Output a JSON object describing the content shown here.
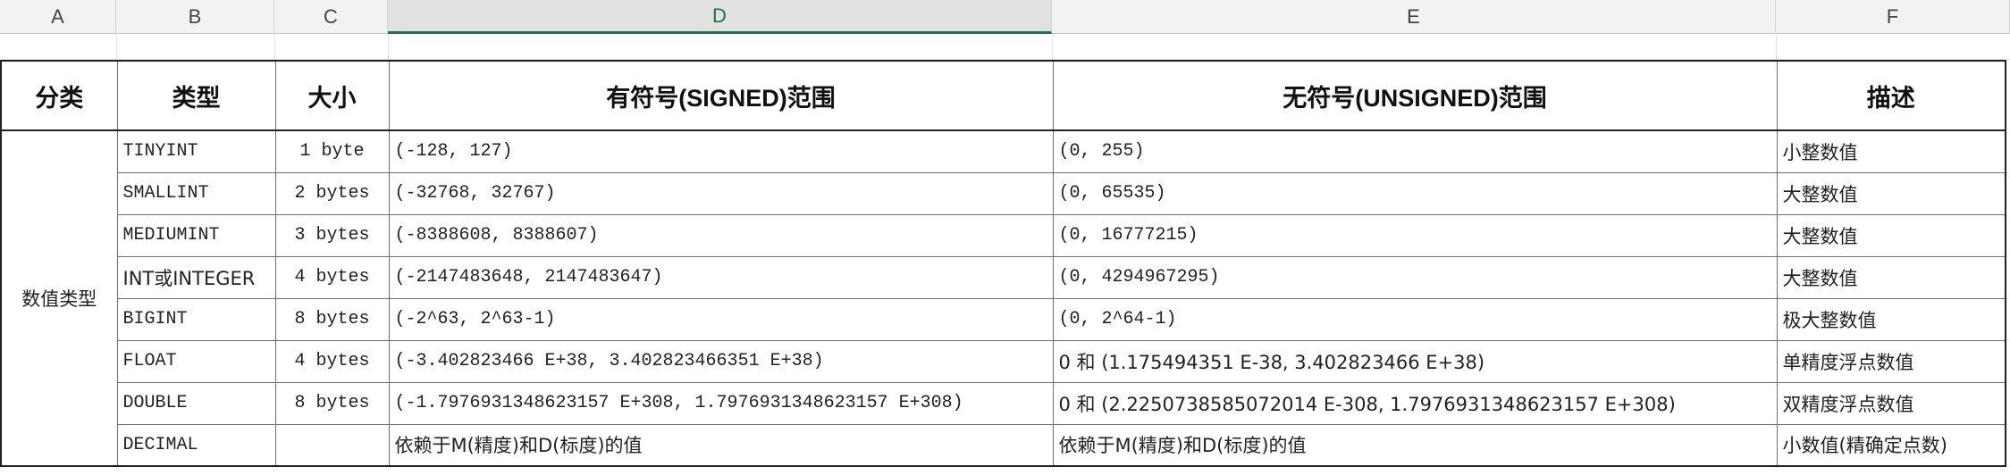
{
  "columns": [
    "A",
    "B",
    "C",
    "D",
    "E",
    "F"
  ],
  "active_column": "D",
  "table": {
    "headers": {
      "category": "分类",
      "type": "类型",
      "size": "大小",
      "signed": "有符号(SIGNED)范围",
      "unsigned": "无符号(UNSIGNED)范围",
      "desc": "描述"
    },
    "category": "数值类型",
    "rows": [
      {
        "type": "TINYINT",
        "size": "1 byte",
        "signed": "(-128, 127)",
        "unsigned": "(0, 255)",
        "desc": "小整数值"
      },
      {
        "type": "SMALLINT",
        "size": "2 bytes",
        "signed": "(-32768, 32767)",
        "unsigned": "(0, 65535)",
        "desc": "大整数值"
      },
      {
        "type": "MEDIUMINT",
        "size": "3 bytes",
        "signed": "(-8388608, 8388607)",
        "unsigned": "(0, 16777215)",
        "desc": "大整数值"
      },
      {
        "type": "INT或INTEGER",
        "size": "4 bytes",
        "signed": "(-2147483648, 2147483647)",
        "unsigned": "(0, 4294967295)",
        "desc": "大整数值"
      },
      {
        "type": "BIGINT",
        "size": "8 bytes",
        "signed": "(-2^63, 2^63-1)",
        "unsigned": "(0, 2^64-1)",
        "desc": "极大整数值"
      },
      {
        "type": "FLOAT",
        "size": "4 bytes",
        "signed": "(-3.402823466 E+38, 3.402823466351 E+38)",
        "unsigned": "0 和 (1.175494351 E-38, 3.402823466 E+38)",
        "desc": "单精度浮点数值"
      },
      {
        "type": "DOUBLE",
        "size": "8 bytes",
        "signed": "(-1.7976931348623157 E+308, 1.7976931348623157 E+308)",
        "unsigned": "0 和 (2.2250738585072014 E-308, 1.7976931348623157 E+308)",
        "desc": "双精度浮点数值"
      },
      {
        "type": "DECIMAL",
        "size": "",
        "signed": "依赖于M(精度)和D(标度)的值",
        "unsigned": "依赖于M(精度)和D(标度)的值",
        "desc": "小数值(精确定点数)"
      }
    ]
  }
}
